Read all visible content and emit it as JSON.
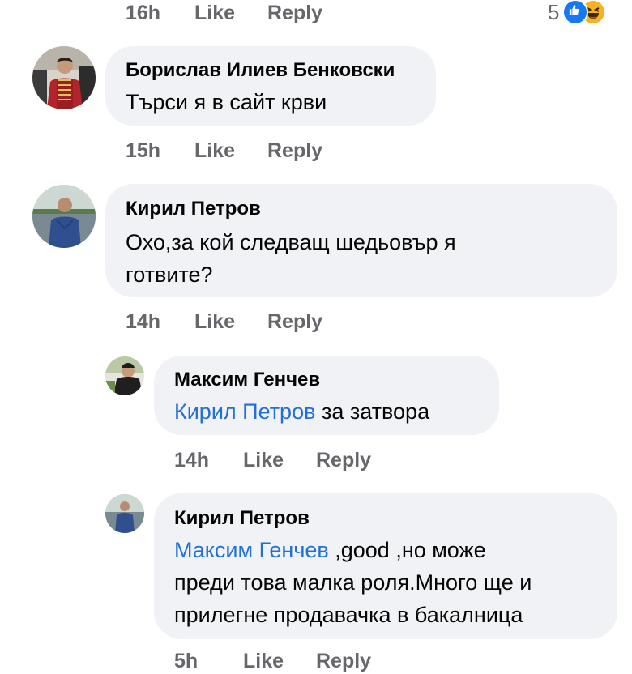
{
  "top": {
    "time": "16h",
    "like_label": "Like",
    "reply_label": "Reply",
    "reaction_count": "5",
    "reaction_icons": [
      "like-icon",
      "haha-icon"
    ]
  },
  "comments": [
    {
      "author": "Борислав Илиев Бенковски",
      "text": "Търси я в сайт крви",
      "time": "15h",
      "like_label": "Like",
      "reply_label": "Reply"
    },
    {
      "author": "Кирил Петров",
      "text_line1": "Охо,за кой следващ шедьовър я",
      "text_line2": "готвите?",
      "time": "14h",
      "like_label": "Like",
      "reply_label": "Reply"
    },
    {
      "author": "Максим Генчев",
      "mention": "Кирил Петров",
      "text": " за затвора",
      "time": "14h",
      "like_label": "Like",
      "reply_label": "Reply"
    },
    {
      "author": "Кирил Петров",
      "mention": "Максим Генчев",
      "text_line1": " ,good ,но може",
      "text_line2": "преди това малка роля.Много ще и",
      "text_line3": "прилегне продавачка в бакалница",
      "time": "5h",
      "like_label": "Like",
      "reply_label": "Reply"
    }
  ],
  "colors": {
    "bubble": "#f0f2f5",
    "meta_text": "#65676b",
    "mention": "#216fdb",
    "like_reaction": "#1877f2",
    "haha_reaction": "#f7b125"
  }
}
